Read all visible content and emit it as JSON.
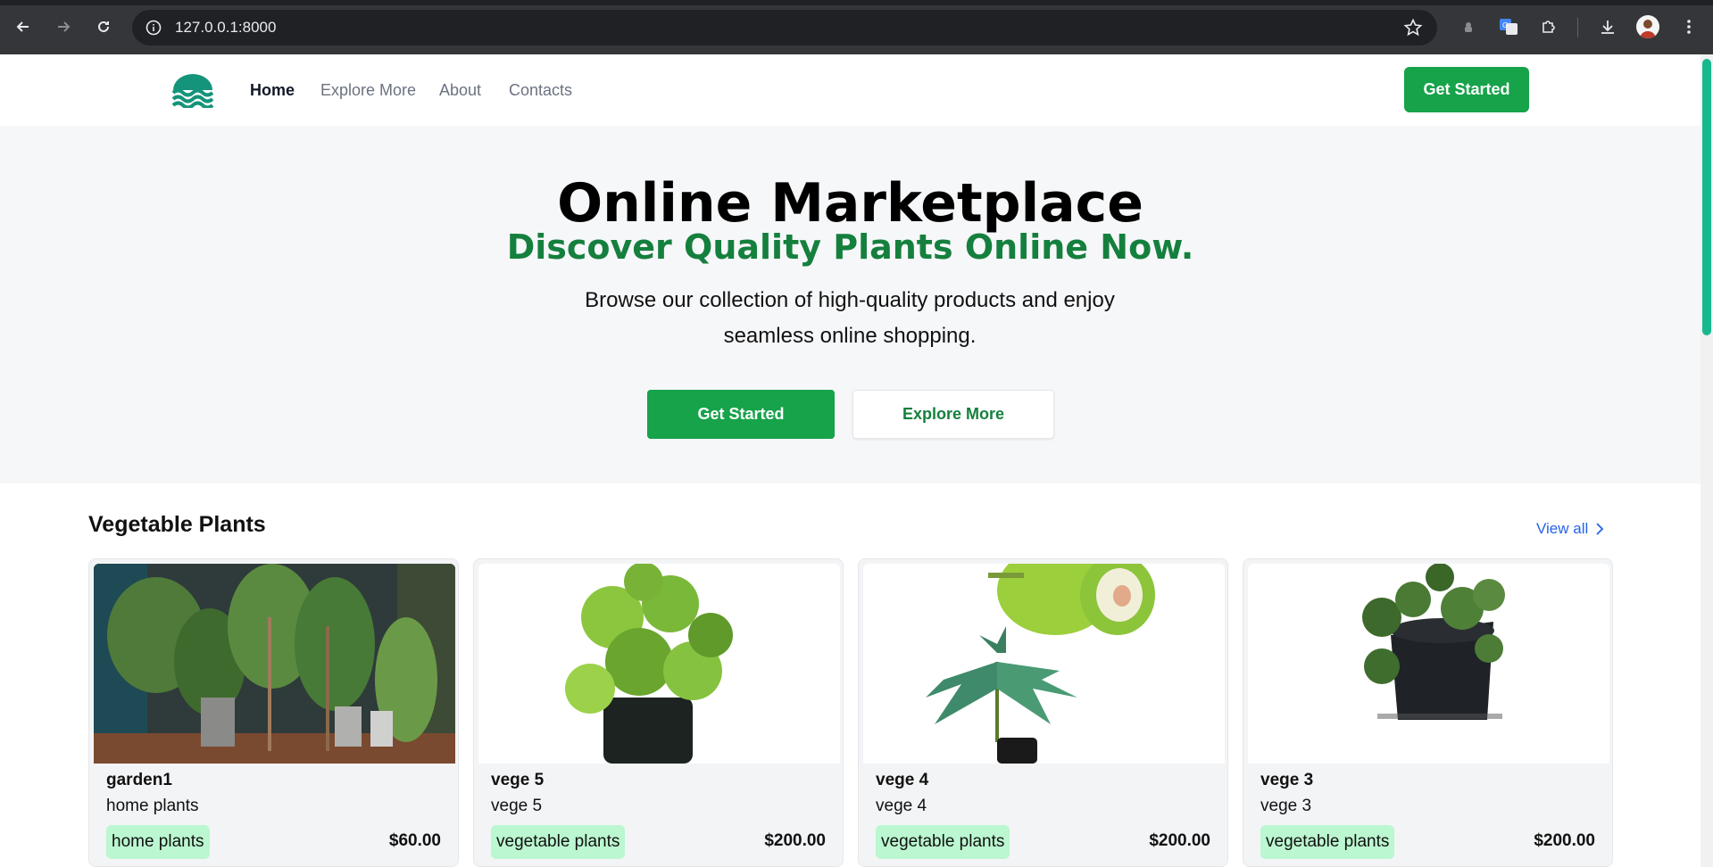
{
  "browser": {
    "url": "127.0.0.1:8000"
  },
  "nav": {
    "links": [
      {
        "label": "Home"
      },
      {
        "label": "Explore More"
      },
      {
        "label": "About"
      },
      {
        "label": "Contacts"
      }
    ],
    "cta_label": "Get Started"
  },
  "hero": {
    "title": "Online Marketplace",
    "subtitle": "Discover Quality Plants Online Now.",
    "description": "Browse our collection of high-quality products and enjoy seamless online shopping.",
    "primary_button": "Get Started",
    "secondary_button": "Explore More"
  },
  "section": {
    "title": "Vegetable Plants",
    "view_all": "View all"
  },
  "products": [
    {
      "name": "garden1",
      "description": "home plants",
      "tag": "home plants",
      "price": "$60.00"
    },
    {
      "name": "vege 5",
      "description": "vege 5",
      "tag": "vegetable plants",
      "price": "$200.00"
    },
    {
      "name": "vege 4",
      "description": "vege 4",
      "tag": "vegetable plants",
      "price": "$200.00"
    },
    {
      "name": "vege 3",
      "description": "vege 3",
      "tag": "vegetable plants",
      "price": "$200.00"
    }
  ],
  "colors": {
    "brand_green": "#16a34a",
    "subtitle_green": "#15803d",
    "tag_green": "#bbf7d0",
    "link_blue": "#2563eb",
    "logo_teal": "#14947a"
  }
}
